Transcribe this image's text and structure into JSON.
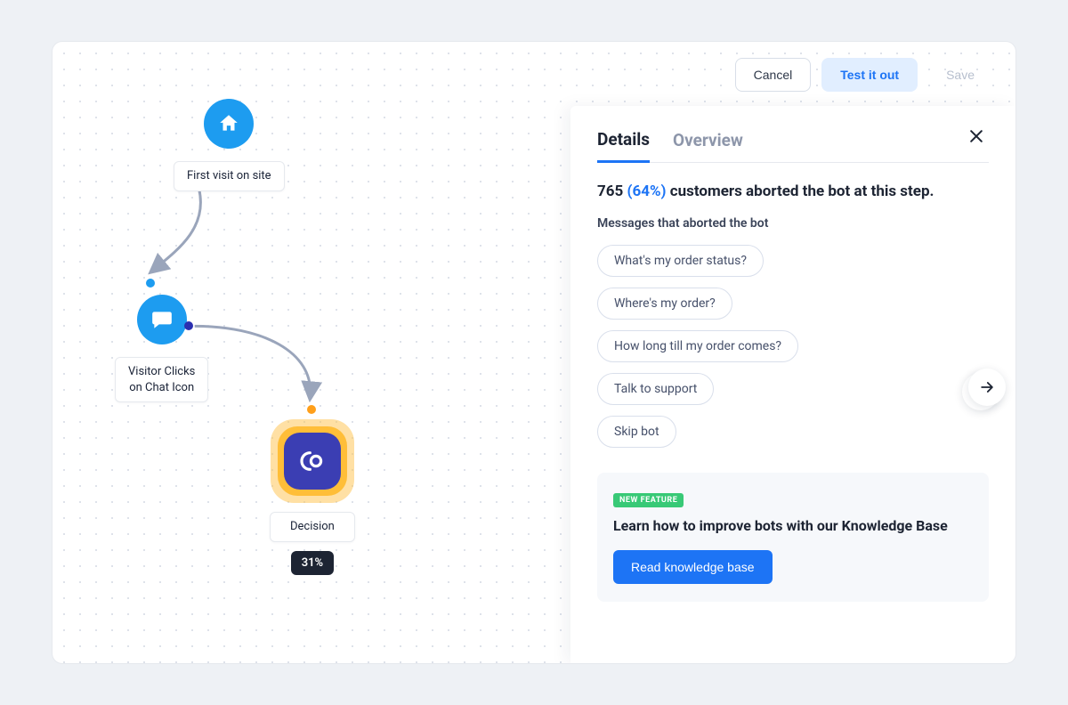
{
  "actions": {
    "cancel": "Cancel",
    "test": "Test it out",
    "save": "Save"
  },
  "flow": {
    "node1": {
      "label": "First visit on site"
    },
    "node2": {
      "label": "Visitor Clicks\non Chat Icon"
    },
    "node3": {
      "label": "Decision",
      "badge": "31%"
    }
  },
  "panel": {
    "tabs": {
      "details": "Details",
      "overview": "Overview"
    },
    "summary_count": "765",
    "summary_pct": "(64%)",
    "summary_rest": "customers aborted the bot at this step.",
    "section_label": "Messages that aborted the bot",
    "messages": [
      "What's my order status?",
      "Where's my order?",
      "How long till my order comes?",
      "Talk to support",
      "Skip bot"
    ],
    "kb": {
      "badge": "NEW FEATURE",
      "title": "Learn how to improve bots with our Knowledge Base",
      "button": "Read knowledge base"
    }
  },
  "colors": {
    "accent_blue": "#1d74f5",
    "node_blue": "#1d9cf0",
    "decision_purple": "#3b3eb3",
    "decision_glow": "#ffbe38",
    "orange_dot": "#ff9f1a",
    "dark_dot": "#2b2fb0"
  }
}
